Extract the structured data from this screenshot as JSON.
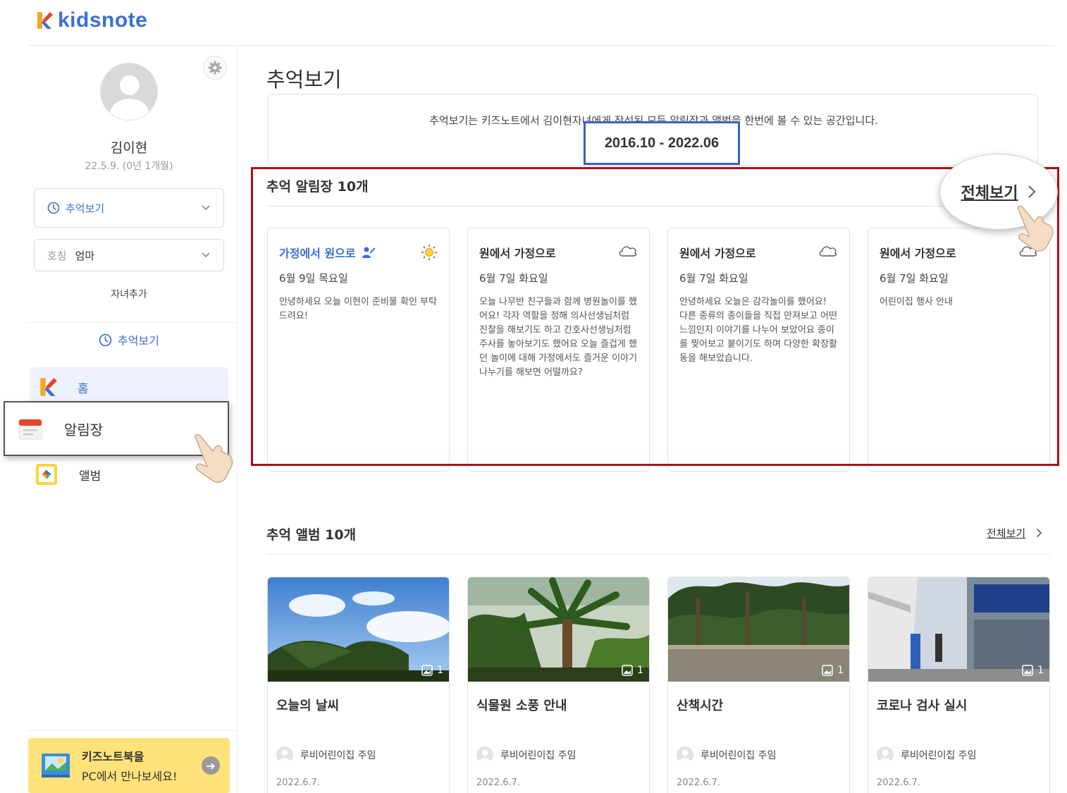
{
  "app": {
    "logo_text": "kidsnote"
  },
  "sidebar": {
    "child_name": "김이현",
    "child_birth": "22.5.9. (0년 1개월)",
    "menu_select": "추억보기",
    "relation_label": "호칭",
    "relation_value": "엄마",
    "add_child": "자녀추가",
    "memory_link": "추억보기",
    "nav": {
      "home": "홈",
      "notice": "알림장",
      "album": "앨범"
    },
    "promo": {
      "line1": "키즈노트북을",
      "line2": "PC에서 만나보세요!"
    }
  },
  "main": {
    "title": "추억보기",
    "intro": "추억보기는 키즈노트에서  김이현자녀에게 작성된 모든 알림장과 앨범을 한번에 볼 수 있는 공간입니다.",
    "date_range": "2016.10 - 2022.06",
    "notice_section": {
      "title": "추억 알림장 10개",
      "see_all": "전체보기",
      "cards": [
        {
          "title": "가정에서 원으로",
          "date": "6월 9일 목요일",
          "body": "안녕하세요 오늘 이현이 준비물 확인 부탁드려요!",
          "weather_icon": "sun-icon"
        },
        {
          "title": "원에서 가정으로",
          "date": "6월 7일 화요일",
          "body": "오늘 나무반 친구들과 함께 병원놀이를 했어요! 각자 역할을 정해 의사선생님처럼 진찰을 해보기도 하고 간호사선생님처럼 주사를 놓아보기도 했어요 오늘 즐겁게 했던 놀이에 대해 가정에서도 즐거운 이야기 나누기를 해보면 어떨까요?",
          "weather_icon": "cloud-icon"
        },
        {
          "title": "원에서 가정으로",
          "date": "6월 7일 화요일",
          "body": "안녕하세요 오늘은 감각놀이를 했어요! 다른 종류의 종이들을 직접 만져보고 어떤 느낌인지 이야기를 나누어 보았어요 종이를 찢어보고 붙이기도 하며 다양한 확장활동을 해보았습니다.",
          "weather_icon": "cloud-icon"
        },
        {
          "title": "원에서 가정으로",
          "date": "6월 7일 화요일",
          "body": "어린이집 행사 안내",
          "weather_icon": "cloud-icon"
        }
      ]
    },
    "album_section": {
      "title": "추억 앨범 10개",
      "see_all": "전체보기",
      "cards": [
        {
          "title": "오늘의 날씨",
          "count": "1",
          "author": "루비어린이집 주임",
          "date": "2022.6.7."
        },
        {
          "title": "식물원 소풍 안내",
          "count": "1",
          "author": "루비어린이집 주임",
          "date": "2022.6.7."
        },
        {
          "title": "산책시간",
          "count": "1",
          "author": "루비어린이집 주임",
          "date": "2022.6.7."
        },
        {
          "title": "코로나 검사 실시",
          "count": "1",
          "author": "루비어린이집 주임",
          "date": "2022.6.7."
        }
      ]
    }
  },
  "colors": {
    "brand_blue": "#3b6fd8",
    "highlight_red": "#b30d15",
    "highlight_blue": "#3b62b8",
    "promo_yellow": "#ffe37a"
  }
}
